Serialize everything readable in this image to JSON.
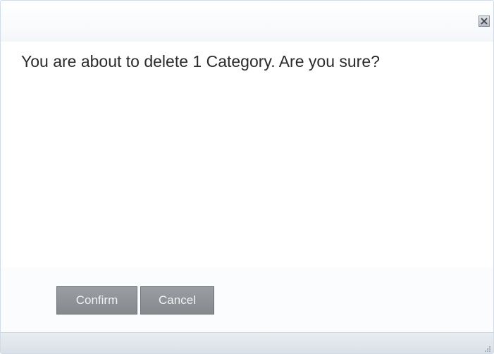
{
  "dialog": {
    "message": "You are about to delete 1 Category. Are you sure?",
    "close_icon": "close-icon",
    "buttons": {
      "confirm_label": "Confirm",
      "cancel_label": "Cancel"
    },
    "resize_icon": "resize-grip-icon"
  },
  "colors": {
    "button_bg": "#8f9397",
    "button_text": "#f2f2f2",
    "footer_bg": "#dde3ea",
    "message_text": "#2b2b2b"
  }
}
